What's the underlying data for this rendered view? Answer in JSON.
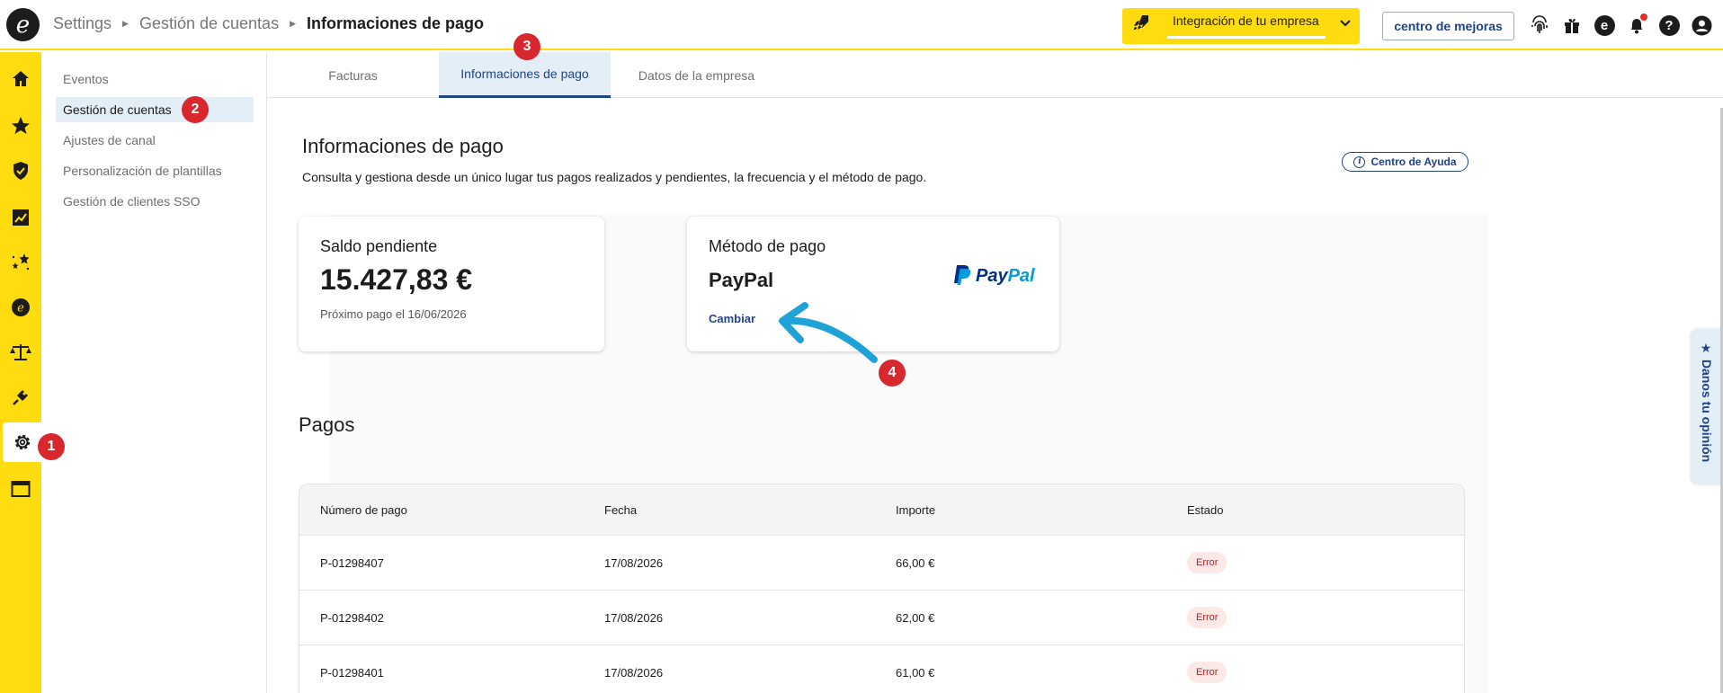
{
  "breadcrumb": [
    "Settings",
    "Gestión de cuentas",
    "Informaciones de pago"
  ],
  "header": {
    "integration_label": "Integración de tu empresa",
    "improvements_label": "centro de mejoras"
  },
  "subnav": [
    "Eventos",
    "Gestión de cuentas",
    "Ajustes de canal",
    "Personalización de plantillas",
    "Gestión de clientes SSO"
  ],
  "tabs": [
    "Facturas",
    "Informaciones de pago",
    "Datos de la empresa"
  ],
  "page": {
    "title": "Informaciones de pago",
    "description": "Consulta y gestiona desde un único lugar tus pagos realizados y pendientes, la frecuencia y el método de pago.",
    "help_label": "Centro de Ayuda"
  },
  "balance_card": {
    "title": "Saldo pendiente",
    "amount": "15.427,83 €",
    "next_payment": "Próximo pago el 16/06/2026"
  },
  "method_card": {
    "title": "Método de pago",
    "method": "PayPal",
    "change_label": "Cambiar",
    "logo_text_1": "Pay",
    "logo_text_2": "Pal"
  },
  "payments": {
    "title": "Pagos",
    "columns": [
      "Número de pago",
      "Fecha",
      "Importe",
      "Estado"
    ],
    "rows": [
      {
        "id": "P-01298407",
        "date": "17/08/2026",
        "amount": "66,00 €",
        "status": "Error"
      },
      {
        "id": "P-01298402",
        "date": "17/08/2026",
        "amount": "62,00 €",
        "status": "Error"
      },
      {
        "id": "P-01298401",
        "date": "17/08/2026",
        "amount": "61,00 €",
        "status": "Error"
      }
    ]
  },
  "steps": [
    "1",
    "2",
    "3",
    "4"
  ],
  "feedback_label": "★ Danos tu opinión",
  "colors": {
    "brand_yellow": "#ffdc0f",
    "brand_blue": "#1f4289",
    "step_red": "#d9272e",
    "annotation_arrow": "#1fa3d6",
    "error_badge_bg": "#fde8e8"
  },
  "icons": {
    "rail": [
      "home-icon",
      "star-icon",
      "shield-check-icon",
      "analytics-icon",
      "sparkles-icon",
      "trusted-logo-icon",
      "scales-icon",
      "plug-icon",
      "gear-icon",
      "browser-window-icon"
    ],
    "top": [
      "fingerprint-icon",
      "gift-icon",
      "trusted-logo-icon",
      "bell-icon",
      "help-icon",
      "user-icon"
    ]
  }
}
